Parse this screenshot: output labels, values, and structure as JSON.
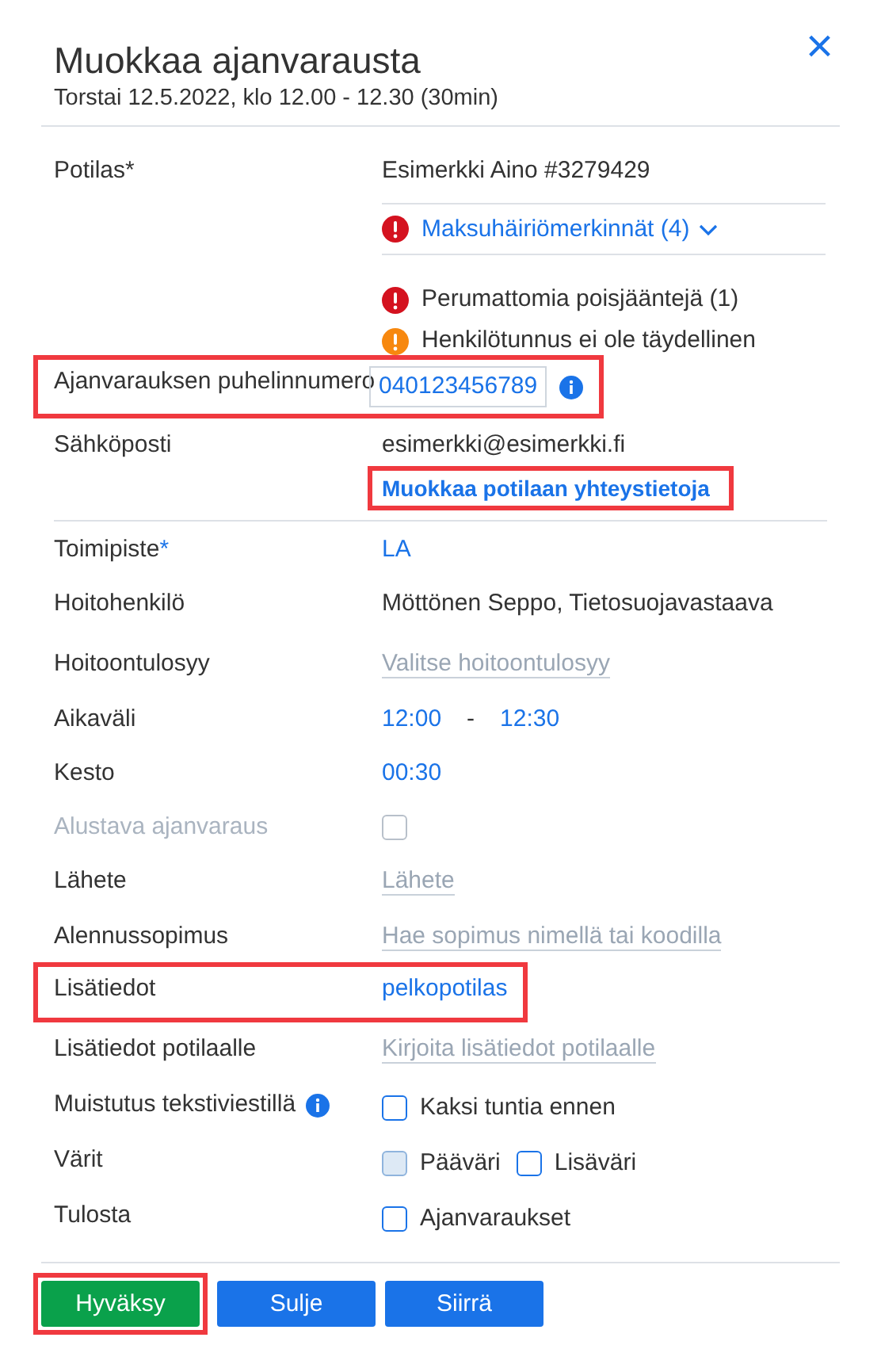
{
  "dialog": {
    "title": "Muokkaa ajanvarausta",
    "subtitle": "Torstai 12.5.2022, klo 12.00 - 12.30 (30min)",
    "close": "×"
  },
  "rows": [
    {
      "kind": "patient",
      "label": "Potilas*",
      "value": "Esimerkki Aino  #3279429",
      "dropdown": {
        "text": "Maksuhäiriömerkinnät (4)",
        "expanded": false
      },
      "warnings": [
        {
          "text": "Perumattomia poisjääntejä (1)",
          "kind": "error"
        },
        {
          "text": "Henkilötunnus ei ole täydellinen",
          "kind": "warning"
        }
      ]
    },
    {
      "kind": "phone",
      "label": "Ajanvarauksen puhelinnumero",
      "value": "040123456789",
      "highlighted": true
    },
    {
      "kind": "email",
      "label": "Sähköposti",
      "value": "esimerkki@esimerkki.fi",
      "link": {
        "text": "Muokkaa potilaan yhteystietoja",
        "highlighted": true
      }
    },
    {
      "kind": "link",
      "label": "Toimipiste",
      "required_mark": "*",
      "value": "LA"
    },
    {
      "kind": "text",
      "label": "Hoitohenkilö",
      "value": "Möttönen Seppo, Tietosuojavastaava"
    },
    {
      "kind": "placeholder",
      "label": "Hoitoontulosyy",
      "placeholder": "Valitse hoitoontulosyy"
    },
    {
      "kind": "time-range",
      "label": "Aikaväli",
      "start": "12:00",
      "separator": "-",
      "end": "12:30"
    },
    {
      "kind": "link",
      "label": "Kesto",
      "value": "00:30"
    },
    {
      "kind": "checkbox",
      "label": "Alustava ajanvaraus",
      "disabled": true,
      "checked": false
    },
    {
      "kind": "placeholder",
      "label": "Lähete",
      "placeholder": "Lähete"
    },
    {
      "kind": "placeholder",
      "label": "Alennussopimus",
      "placeholder": "Hae sopimus nimellä tai koodilla"
    },
    {
      "kind": "link",
      "label": "Lisätiedot",
      "value": "pelkopotilas",
      "highlighted": true
    },
    {
      "kind": "placeholder",
      "label": "Lisätiedot potilaalle",
      "placeholder": "Kirjoita lisätiedot potilaalle"
    },
    {
      "kind": "checkboxes",
      "label": "Muistutus tekstiviestillä",
      "info": true,
      "options": [
        {
          "text": "Kaksi tuntia ennen",
          "checked": false
        }
      ]
    },
    {
      "kind": "checkboxes",
      "label": "Värit",
      "options": [
        {
          "text": "Pääväri",
          "checked": false,
          "filled": true
        },
        {
          "text": "Lisäväri",
          "checked": false
        }
      ]
    },
    {
      "kind": "checkboxes",
      "label": "Tulosta",
      "options": [
        {
          "text": "Ajanvaraukset",
          "checked": false
        }
      ]
    }
  ],
  "buttons": [
    {
      "text": "Hyväksy",
      "kind": "primary",
      "highlighted": true
    },
    {
      "text": "Sulje",
      "kind": "secondary",
      "highlighted": false
    },
    {
      "text": "Siirrä",
      "kind": "secondary",
      "highlighted": false
    }
  ]
}
